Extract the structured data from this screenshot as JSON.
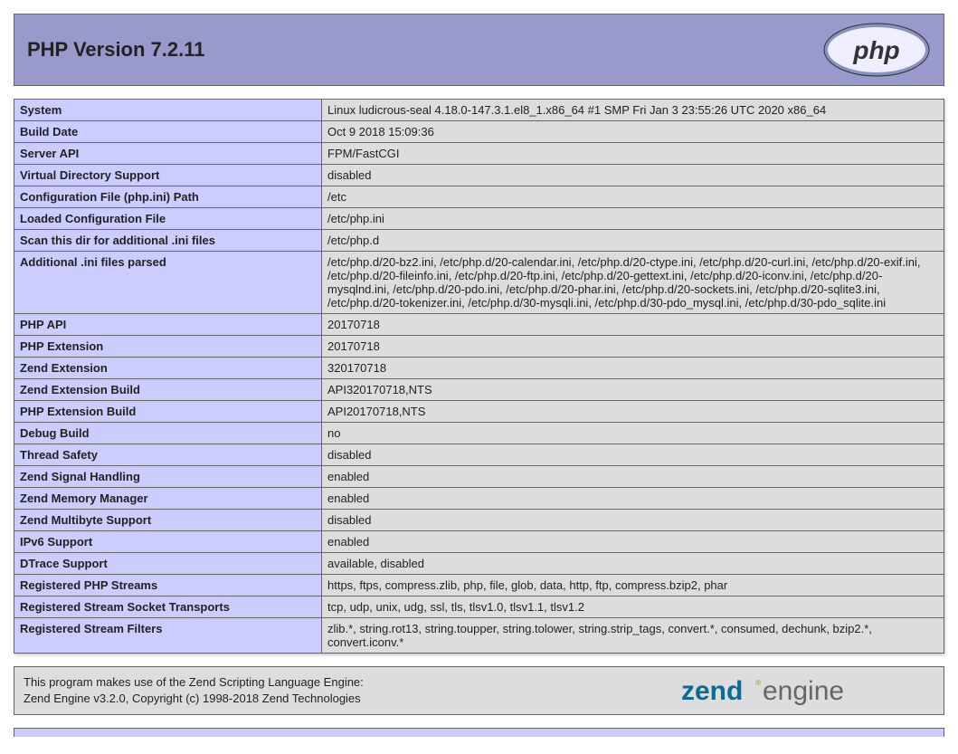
{
  "header": {
    "title": "PHP Version 7.2.11"
  },
  "rows": [
    {
      "label": "System",
      "value": "Linux ludicrous-seal 4.18.0-147.3.1.el8_1.x86_64 #1 SMP Fri Jan 3 23:55:26 UTC 2020 x86_64"
    },
    {
      "label": "Build Date",
      "value": "Oct 9 2018 15:09:36"
    },
    {
      "label": "Server API",
      "value": "FPM/FastCGI"
    },
    {
      "label": "Virtual Directory Support",
      "value": "disabled"
    },
    {
      "label": "Configuration File (php.ini) Path",
      "value": "/etc"
    },
    {
      "label": "Loaded Configuration File",
      "value": "/etc/php.ini"
    },
    {
      "label": "Scan this dir for additional .ini files",
      "value": "/etc/php.d"
    },
    {
      "label": "Additional .ini files parsed",
      "value": "/etc/php.d/20-bz2.ini, /etc/php.d/20-calendar.ini, /etc/php.d/20-ctype.ini, /etc/php.d/20-curl.ini, /etc/php.d/20-exif.ini, /etc/php.d/20-fileinfo.ini, /etc/php.d/20-ftp.ini, /etc/php.d/20-gettext.ini, /etc/php.d/20-iconv.ini, /etc/php.d/20-mysqlnd.ini, /etc/php.d/20-pdo.ini, /etc/php.d/20-phar.ini, /etc/php.d/20-sockets.ini, /etc/php.d/20-sqlite3.ini, /etc/php.d/20-tokenizer.ini, /etc/php.d/30-mysqli.ini, /etc/php.d/30-pdo_mysql.ini, /etc/php.d/30-pdo_sqlite.ini"
    },
    {
      "label": "PHP API",
      "value": "20170718"
    },
    {
      "label": "PHP Extension",
      "value": "20170718"
    },
    {
      "label": "Zend Extension",
      "value": "320170718"
    },
    {
      "label": "Zend Extension Build",
      "value": "API320170718,NTS"
    },
    {
      "label": "PHP Extension Build",
      "value": "API20170718,NTS"
    },
    {
      "label": "Debug Build",
      "value": "no"
    },
    {
      "label": "Thread Safety",
      "value": "disabled"
    },
    {
      "label": "Zend Signal Handling",
      "value": "enabled"
    },
    {
      "label": "Zend Memory Manager",
      "value": "enabled"
    },
    {
      "label": "Zend Multibyte Support",
      "value": "disabled"
    },
    {
      "label": "IPv6 Support",
      "value": "enabled"
    },
    {
      "label": "DTrace Support",
      "value": "available, disabled"
    },
    {
      "label": "Registered PHP Streams",
      "value": "https, ftps, compress.zlib, php, file, glob, data, http, ftp, compress.bzip2, phar"
    },
    {
      "label": "Registered Stream Socket Transports",
      "value": "tcp, udp, unix, udg, ssl, tls, tlsv1.0, tlsv1.1, tlsv1.2"
    },
    {
      "label": "Registered Stream Filters",
      "value": "zlib.*, string.rot13, string.toupper, string.tolower, string.strip_tags, convert.*, consumed, dechunk, bzip2.*, convert.iconv.*"
    }
  ],
  "zend": {
    "line1": "This program makes use of the Zend Scripting Language Engine:",
    "line2": "Zend Engine v3.2.0, Copyright (c) 1998-2018 Zend Technologies"
  }
}
